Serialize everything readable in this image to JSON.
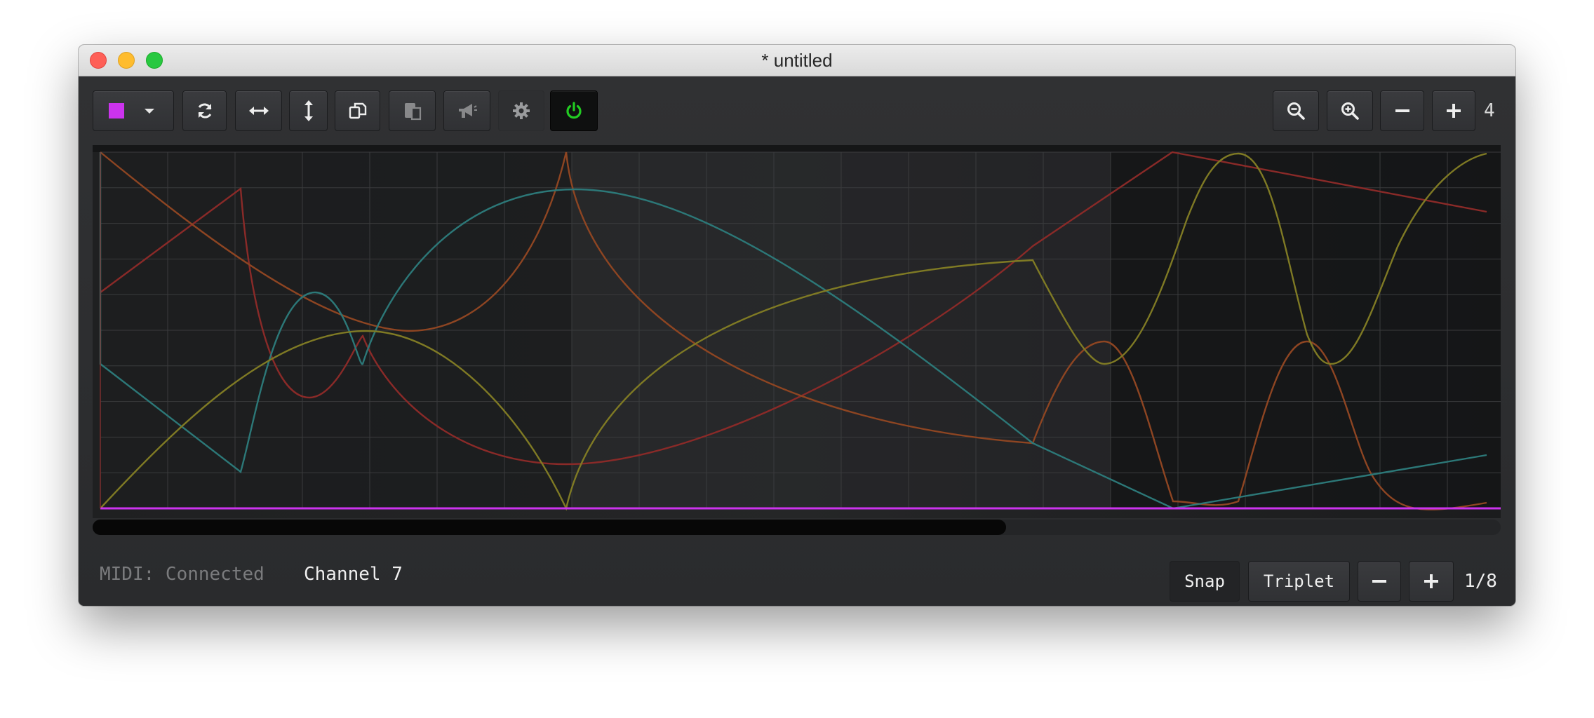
{
  "window": {
    "title": "* untitled"
  },
  "toolbar": {
    "buttons": [
      {
        "name": "color-select-button",
        "icon": "color-swatch-dropdown-icon",
        "color": "#cc33ee"
      },
      {
        "name": "refresh-button",
        "icon": "refresh-icon"
      },
      {
        "name": "stretch-horizontal-button",
        "icon": "arrows-horizontal-icon"
      },
      {
        "name": "stretch-vertical-button",
        "icon": "arrows-vertical-icon"
      },
      {
        "name": "copy-button",
        "icon": "copy-icon"
      },
      {
        "name": "paste-button",
        "icon": "paste-icon",
        "disabled": true
      },
      {
        "name": "broadcast-button",
        "icon": "megaphone-icon",
        "disabled": true
      },
      {
        "name": "settings-button",
        "icon": "gear-icon"
      },
      {
        "name": "power-button",
        "icon": "power-icon",
        "color": "#22cc22"
      }
    ],
    "zoom_buttons": [
      {
        "name": "zoom-out-button",
        "icon": "zoom-out-icon"
      },
      {
        "name": "zoom-in-button",
        "icon": "zoom-in-icon"
      },
      {
        "name": "decrease-button",
        "icon": "minus-icon"
      },
      {
        "name": "increase-button",
        "icon": "plus-icon"
      }
    ],
    "zoom_value": "4"
  },
  "editor": {
    "colors": {
      "background": "#1a1b1c",
      "grid": "#3a3b3d",
      "baseline": "#cc33ee",
      "curve_red": "#8a2a28",
      "curve_orange": "#8e4522",
      "curve_teal": "#2c7878",
      "curve_olive": "#7f7a24"
    }
  },
  "status": {
    "midi": "MIDI: Connected",
    "channel": "Channel 7"
  },
  "bottom_controls": {
    "snap_label": "Snap",
    "triplet_label": "Triplet",
    "grid_value": "1/8"
  }
}
